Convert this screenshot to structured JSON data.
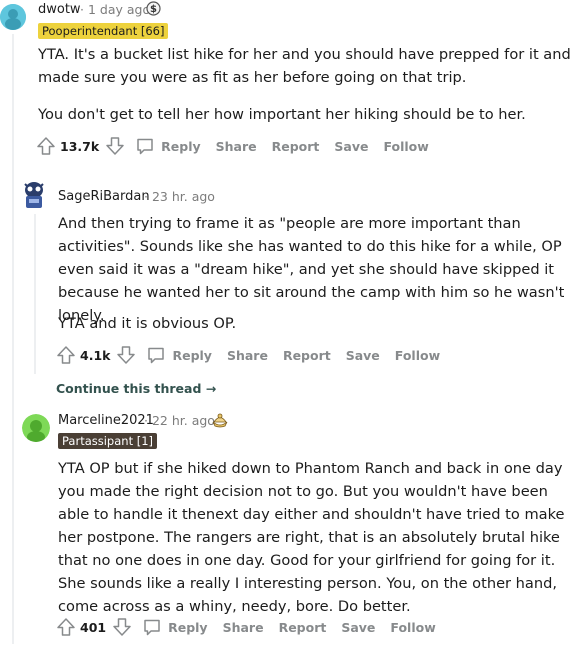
{
  "comments": [
    {
      "username": "dwotw",
      "age": "1 day ago",
      "flair": "Pooperintendant [66]",
      "paragraphs": [
        "YTA. It's a bucket list hike for her and you should have prepped for it and made sure you were as fit as her before going on that trip.",
        "You don't get to tell her how important her hiking should be to her."
      ],
      "score": "13.7k"
    },
    {
      "username": "SageRiBardan",
      "age": "23 hr. ago",
      "paragraphs": [
        "And then trying to frame it as \"people are more important than activities\". Sounds like she has wanted to do this hike for a while, OP even said it was a \"dream hike\", and yet she should have skipped it because he wanted her to sit around the camp with him so he wasn't lonely.",
        "YTA and it is obvious OP."
      ],
      "score": "4.1k"
    },
    {
      "username": "Marceline2021",
      "age": "22 hr. ago",
      "flair": "Partassipant [1]",
      "paragraphs": [
        "YTA OP but if she hiked down to Phantom Ranch and back in one day you made the right decision not to go. But you wouldn't have been able to handle it thenext day either and shouldn't have tried to make her postpone. The rangers are right, that is an absolutely brutal hike that no one does in one day. Good for your girlfriend for going for it. She sounds like a really I interesting person. You, on the other hand, come across as a whiny, needy, bore. Do better."
      ],
      "score": "401"
    }
  ],
  "actions": {
    "reply": "Reply",
    "share": "Share",
    "report": "Report",
    "save": "Save",
    "follow": "Follow"
  },
  "meta_separator": "·",
  "continue_thread": "Continue this thread",
  "continue_arrow": "→",
  "colors": {
    "flair1_bg": "#edd23d",
    "flair2_bg": "#4a3f35",
    "link": "#33524e",
    "muted": "#878a8c"
  }
}
